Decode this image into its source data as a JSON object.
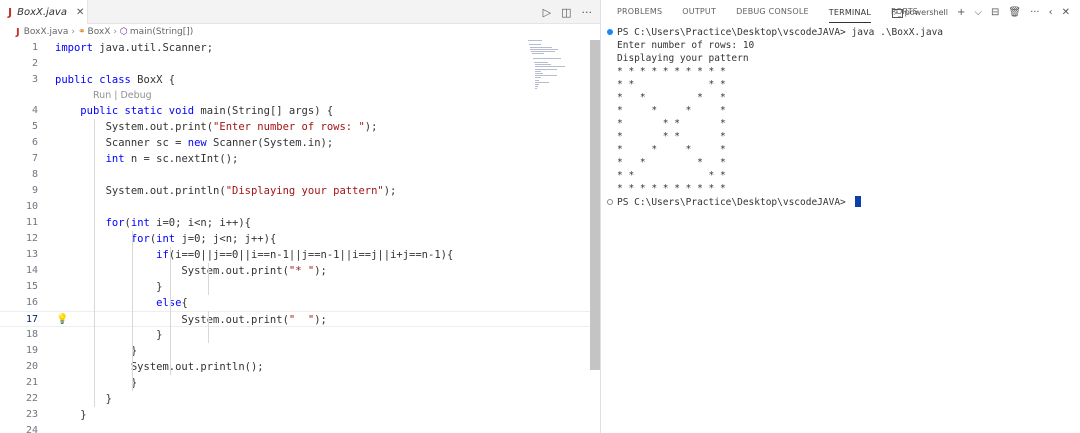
{
  "editor": {
    "tab": {
      "label": "BoxX.java",
      "icon": "java-file-icon"
    },
    "actions": {
      "run": "▷",
      "split": "◫",
      "more": "···"
    },
    "breadcrumb": {
      "file": "BoxX.java",
      "class": "BoxX",
      "method": "main(String[])"
    },
    "codelens": "Run | Debug",
    "active_line": 17,
    "lines": [
      {
        "num": "1",
        "html": "<span class=\"kw\">import</span> java.util.Scanner;"
      },
      {
        "num": "2",
        "html": ""
      },
      {
        "num": "3",
        "html": "<span class=\"kw\">public class</span> BoxX {"
      },
      {
        "num": "4",
        "html": "    <span class=\"kw\">public static void</span> main(String[] args) {"
      },
      {
        "num": "5",
        "html": "        System.out.print(<span class=\"str\">\"Enter number of rows: \"</span>);"
      },
      {
        "num": "6",
        "html": "        Scanner sc = <span class=\"kw\">new</span> Scanner(System.in);"
      },
      {
        "num": "7",
        "html": "        <span class=\"kw\">int</span> n = sc.nextInt();"
      },
      {
        "num": "8",
        "html": ""
      },
      {
        "num": "9",
        "html": "        System.out.println(<span class=\"str\">\"Displaying your pattern\"</span>);"
      },
      {
        "num": "10",
        "html": ""
      },
      {
        "num": "11",
        "html": "        <span class=\"kw\">for</span>(<span class=\"kw\">int</span> i=0; i&lt;n; i++){"
      },
      {
        "num": "12",
        "html": "            <span class=\"kw\">for</span>(<span class=\"kw\">int</span> j=0; j&lt;n; j++){"
      },
      {
        "num": "13",
        "html": "                <span class=\"kw\">if</span>(i==0||j==0||i==n-1||j==n-1||i==j||i+j==n-1){"
      },
      {
        "num": "14",
        "html": "                    System.out.print(<span class=\"str\">\"* \"</span>);"
      },
      {
        "num": "15",
        "html": "                }"
      },
      {
        "num": "16",
        "html": "                <span class=\"kw\">else</span>{"
      },
      {
        "num": "17",
        "html": "                    System.out.print(<span class=\"str\">\"  \"</span>);"
      },
      {
        "num": "18",
        "html": "                }"
      },
      {
        "num": "19",
        "html": "            }"
      },
      {
        "num": "20",
        "html": "            System.out.println();"
      },
      {
        "num": "21",
        "html": "            }"
      },
      {
        "num": "22",
        "html": "        }"
      },
      {
        "num": "23",
        "html": "    }"
      },
      {
        "num": "24",
        "html": ""
      }
    ]
  },
  "panel": {
    "tabs": [
      "PROBLEMS",
      "OUTPUT",
      "DEBUG CONSOLE",
      "TERMINAL",
      "PORTS"
    ],
    "active_tab": "TERMINAL",
    "shell": "powershell",
    "actions": {
      "add": "+",
      "add_menu": "⌵",
      "split": "⊟",
      "kill": "🗑",
      "more": "···",
      "collapse": "‹",
      "close": "✕"
    },
    "terminal_lines": [
      {
        "text": "PS C:\\Users\\Practice\\Desktop\\vscodeJAVA> java .\\BoxX.java",
        "dot": "filled"
      },
      {
        "text": "Enter number of rows: 10"
      },
      {
        "text": "Displaying your pattern"
      },
      {
        "text": "* * * * * * * * * * "
      },
      {
        "text": "* *             * * "
      },
      {
        "text": "*   *         *   * "
      },
      {
        "text": "*     *     *     * "
      },
      {
        "text": "*       * *       * "
      },
      {
        "text": "*       * *       * "
      },
      {
        "text": "*     *     *     * "
      },
      {
        "text": "*   *         *   * "
      },
      {
        "text": "* *             * * "
      },
      {
        "text": "* * * * * * * * * * "
      },
      {
        "text": "PS C:\\Users\\Practice\\Desktop\\vscodeJAVA> ",
        "dot": "hollow",
        "cursor": true
      }
    ]
  }
}
